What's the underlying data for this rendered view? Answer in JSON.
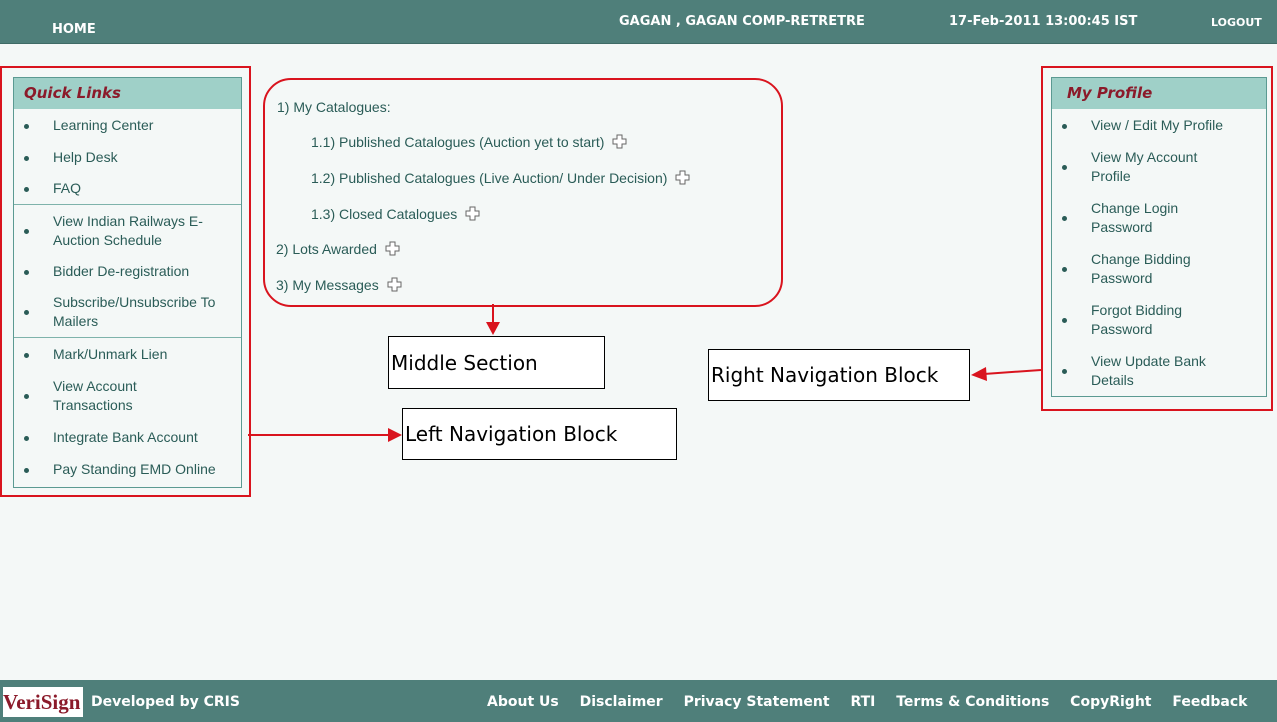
{
  "header": {
    "home_label": "HOME",
    "user_label": "GAGAN , GAGAN COMP-RETRETRE",
    "datetime": "17-Feb-2011 13:00:45 IST",
    "logout_label": "LOGOUT"
  },
  "quick_links": {
    "title": "Quick Links",
    "items": [
      "Learning Center",
      "Help Desk",
      "FAQ",
      "View Indian Railways E-Auction Schedule",
      "Bidder De-registration",
      "Subscribe/Unsubscribe To Mailers",
      "Mark/Unmark Lien",
      "View Account Transactions",
      "Integrate Bank Account",
      "Pay Standing EMD Online"
    ]
  },
  "middle": {
    "my_catalogues": "1)  My Catalogues:",
    "published_yet_to_start": "1.1) Published Catalogues (Auction yet to start)",
    "published_live": "1.2) Published Catalogues (Live Auction/ Under Decision)",
    "closed": "1.3) Closed Catalogues",
    "lots_awarded": "2) Lots Awarded",
    "my_messages": "3) My Messages"
  },
  "my_profile": {
    "title": "My Profile",
    "items": [
      "View / Edit My Profile",
      "View My Account Profile",
      "Change Login Password",
      "Change Bidding Password",
      "Forgot Bidding Password",
      "View Update Bank Details"
    ]
  },
  "annotations": {
    "middle_section": "Middle Section",
    "right_nav": "Right Navigation Block",
    "left_nav": "Left Navigation Block"
  },
  "footer": {
    "logo_text": "VeriSign",
    "developed_by": "Developed by CRIS",
    "links": [
      "About Us",
      "Disclaimer",
      "Privacy Statement",
      "RTI",
      "Terms & Conditions",
      "CopyRight",
      "Feedback"
    ]
  },
  "colors": {
    "header_bg": "#4f7f7a",
    "box_header_bg": "#9fd0c8",
    "box_title": "#8b1a2a",
    "link_text": "#2a5c57",
    "annotation_red": "#d9141e"
  }
}
